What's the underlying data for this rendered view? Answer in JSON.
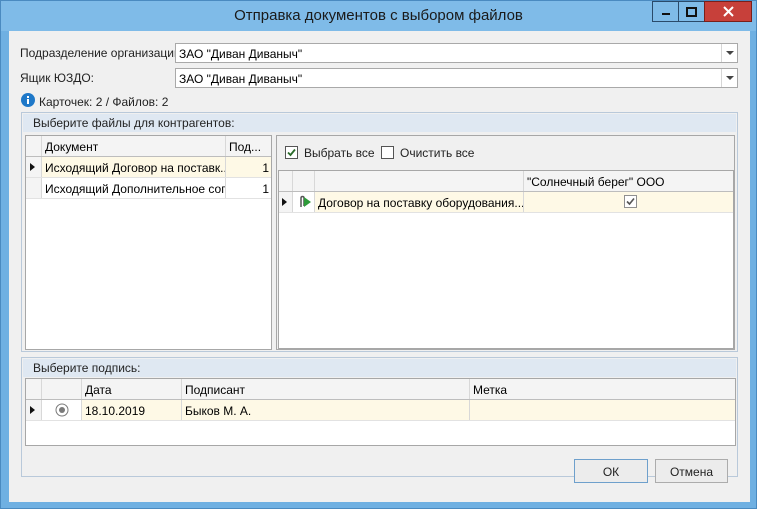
{
  "window": {
    "title": "Отправка документов с выбором файлов"
  },
  "form": {
    "department_label": "Подразделение организации:",
    "department_value": "ЗАО \"Диван Диваныч\"",
    "mailbox_label": "Ящик ЮЗДО:",
    "mailbox_value": "ЗАО \"Диван Диваныч\"",
    "info_text": "Карточек: 2 / Файлов: 2"
  },
  "files_group": {
    "title": "Выберите файлы для контрагентов:",
    "doc_columns": [
      "Документ",
      "Под..."
    ],
    "documents": [
      {
        "name": "Исходящий Договор на поставк...",
        "count": "1"
      },
      {
        "name": "Исходящий Дополнительное сог...",
        "count": "1"
      }
    ],
    "select_all_label": "Выбрать все",
    "clear_all_label": "Очистить все",
    "contractor_column": "\"Солнечный берег\" ООО",
    "files": [
      {
        "name": "Договор на поставку оборудования....",
        "selected": true
      }
    ]
  },
  "signature_group": {
    "title": "Выберите подпись:",
    "columns": [
      "Дата",
      "Подписант",
      "Метка"
    ],
    "rows": [
      {
        "date": "18.10.2019",
        "signer": "Быков М. А.",
        "mark": ""
      }
    ]
  },
  "buttons": {
    "ok": "ОК",
    "cancel": "Отмена"
  },
  "colors": {
    "title_bar": "#7fbbe8",
    "close_button": "#c7403a",
    "group_header": "#dfe8f2",
    "row_highlight": "#fef9e6",
    "info_icon": "#1e78c8"
  },
  "icons": [
    "minimize-icon",
    "maximize-icon",
    "close-icon",
    "info-icon",
    "dropdown-arrow-icon",
    "row-pointer-icon",
    "attachment-icon",
    "checkbox-icon",
    "radio-icon"
  ]
}
